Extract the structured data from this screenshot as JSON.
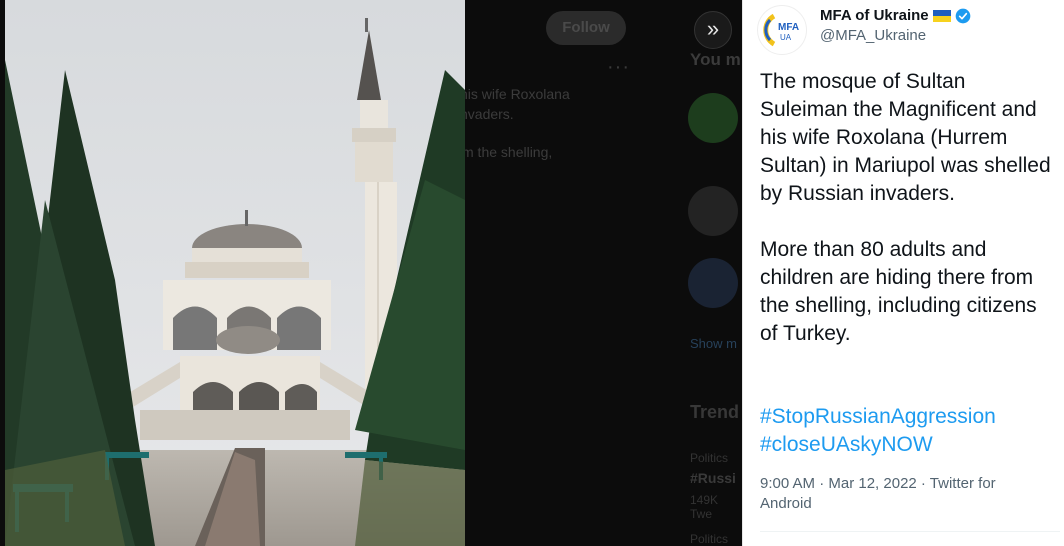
{
  "background_timeline": {
    "follow_label": "Follow",
    "more_label": "···",
    "text_line1": "his wife Roxolana",
    "text_line2": "nvaders.",
    "text_line3": "m the shelling,",
    "you_label": "You m",
    "show_more": "Show m",
    "trends_label": "Trend",
    "trend_category1": "Politics",
    "trend_tag": "#Russi",
    "trend_count": "149K Twe",
    "trend_category2": "Politics"
  },
  "media": {
    "expand_label": "»"
  },
  "tweet": {
    "avatar_text": "MFA",
    "avatar_sub": "UA",
    "display_name": "MFA of Ukraine",
    "handle": "@MFA_Ukraine",
    "paragraph1": "The mosque of Sultan Suleiman the Magnificent and his wife Roxolana (Hurrem Sultan) in Mariupol was shelled by Russian invaders.",
    "paragraph2": "More than 80 adults and children are hiding there from the shelling, including citizens of Turkey.",
    "hashtags": [
      "#StopRussianAggression",
      "#closeUAskyNOW"
    ],
    "timestamp": "9:00 AM · Mar 12, 2022 · Twitter for Android"
  },
  "colors": {
    "link": "#1d9bf0",
    "text": "#0f1419",
    "secondary": "#536471",
    "flag_blue": "#1f5fbf",
    "flag_yellow": "#f7d21e"
  }
}
